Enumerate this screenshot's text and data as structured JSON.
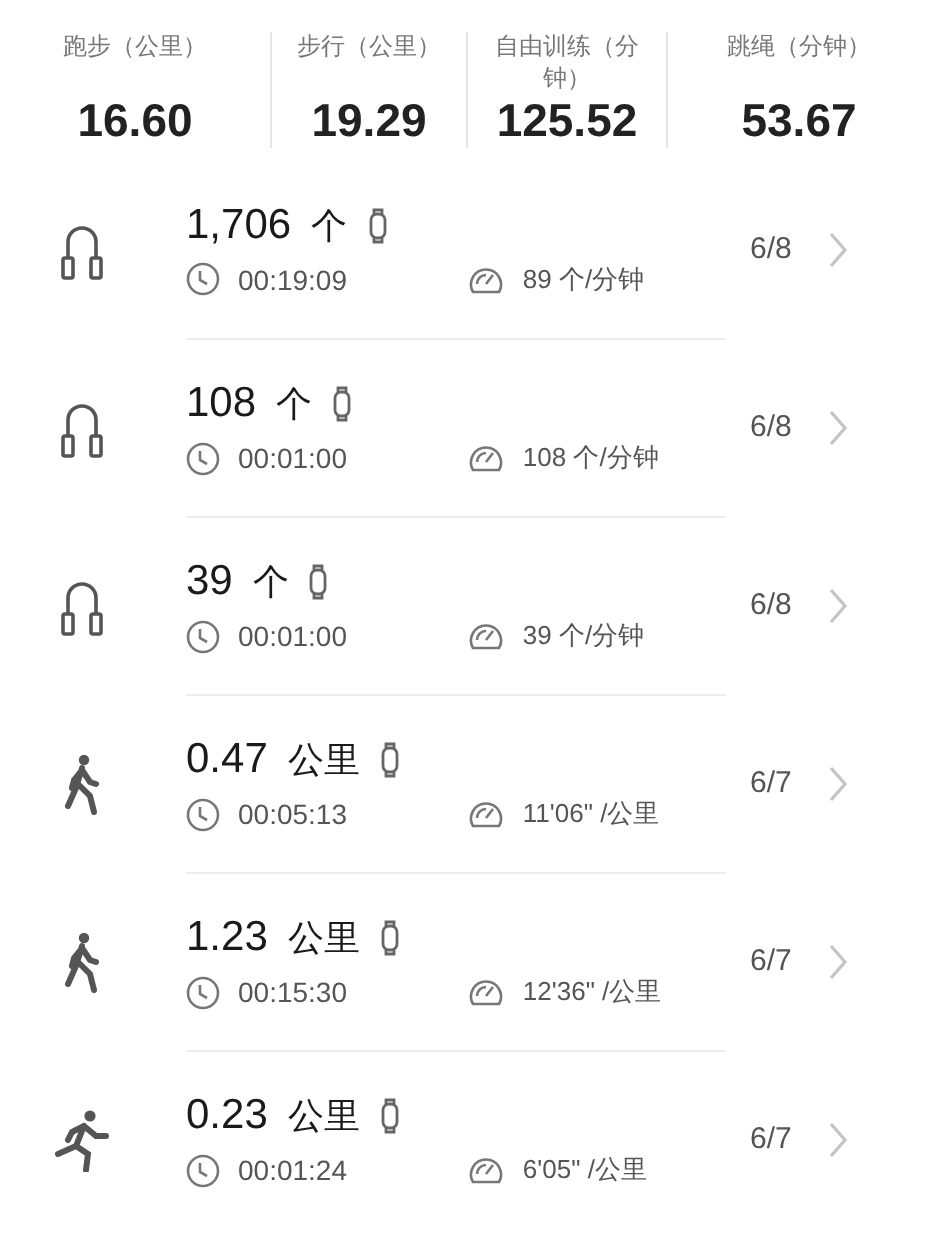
{
  "stats": [
    {
      "label": "跑步（公里）",
      "value": "16.60"
    },
    {
      "label": "步行（公里）",
      "value": "19.29"
    },
    {
      "label": "自由训练（分钟）",
      "value": "125.52"
    },
    {
      "label": "跳绳（分钟）",
      "value": "53.67"
    }
  ],
  "records": [
    {
      "kind": "rope",
      "amount": "1,706",
      "unit": "个",
      "duration": "00:19:09",
      "pace": "89 个/分钟",
      "ratio": "6/8"
    },
    {
      "kind": "rope",
      "amount": "108",
      "unit": "个",
      "duration": "00:01:00",
      "pace": "108 个/分钟",
      "ratio": "6/8"
    },
    {
      "kind": "rope",
      "amount": "39",
      "unit": "个",
      "duration": "00:01:00",
      "pace": "39 个/分钟",
      "ratio": "6/8"
    },
    {
      "kind": "walk",
      "amount": "0.47",
      "unit": "公里",
      "duration": "00:05:13",
      "pace": "11'06\" /公里",
      "ratio": "6/7"
    },
    {
      "kind": "walk",
      "amount": "1.23",
      "unit": "公里",
      "duration": "00:15:30",
      "pace": "12'36\" /公里",
      "ratio": "6/7"
    },
    {
      "kind": "run",
      "amount": "0.23",
      "unit": "公里",
      "duration": "00:01:24",
      "pace": "6'05\" /公里",
      "ratio": "6/7"
    }
  ]
}
